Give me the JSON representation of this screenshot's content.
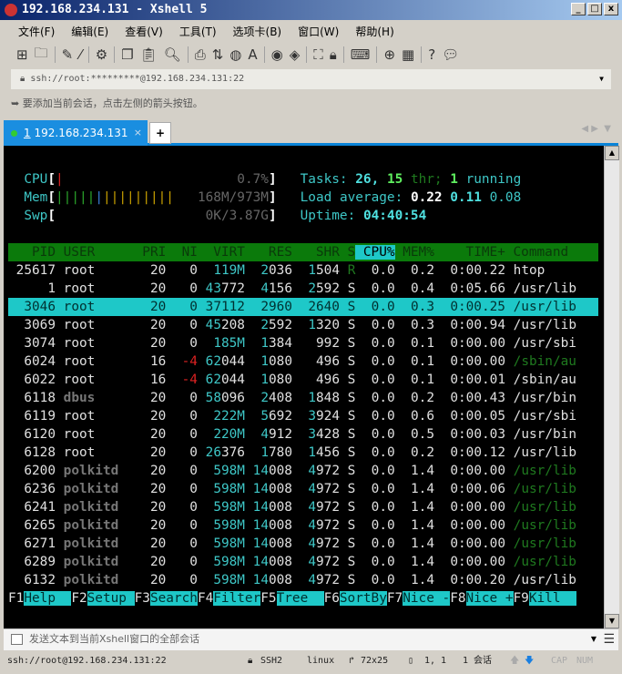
{
  "window": {
    "title": "192.168.234.131 - Xshell 5",
    "min": "_",
    "max": "□",
    "close": "x"
  },
  "menu": [
    "文件(F)",
    "编辑(E)",
    "查看(V)",
    "工具(T)",
    "选项卡(B)",
    "窗口(W)",
    "帮助(H)"
  ],
  "toolbar_icons": [
    "new-session-icon",
    "open-folder-icon",
    "connect-icon",
    "disconnect-icon",
    "properties-icon",
    "copy-icon",
    "paste-icon",
    "find-icon",
    "print-icon",
    "transfer-icon",
    "globe-icon",
    "font-icon",
    "xftp-icon",
    "xmanager-icon",
    "fullscreen-icon",
    "lock-icon",
    "keyboard-icon",
    "new-tab-icon",
    "layout-icon",
    "help-icon",
    "chat-icon"
  ],
  "address": {
    "value": "ssh://root:*********@192.168.234.131:22"
  },
  "hint": "要添加当前会话，点击左侧的箭头按钮。",
  "tab": {
    "number": "1",
    "label": "192.168.234.131",
    "close": "×",
    "add": "+"
  },
  "htop": {
    "cpu": {
      "label": "CPU",
      "percent": "0.7%",
      "bar_fraction": 0.007
    },
    "mem": {
      "label": "Mem",
      "value": "168M/973M",
      "bars": {
        "green": 5,
        "blue": 1,
        "yellow": 9
      }
    },
    "swp": {
      "label": "Swp",
      "value": "0K/3.87G"
    },
    "tasks": {
      "label": "Tasks:",
      "count": "26",
      "thr": "15",
      "thr_label": "thr;",
      "running": "1",
      "running_label": "running"
    },
    "load": {
      "label": "Load average:",
      "values": [
        "0.22",
        "0.11",
        "0.08"
      ]
    },
    "uptime": {
      "label": "Uptime:",
      "value": "04:40:54"
    },
    "columns": [
      "PID",
      "USER",
      "PRI",
      "NI",
      "VIRT",
      "RES",
      "SHR",
      "S",
      "CPU%",
      "MEM%",
      "TIME+",
      "Command"
    ],
    "sort_column": "CPU%",
    "selected_pid": "3046",
    "rows": [
      [
        "25617",
        "root",
        "20",
        "0",
        "119M",
        "2036",
        "1504",
        "R",
        "0.0",
        "0.2",
        "0:00.22",
        "htop",
        false
      ],
      [
        "1",
        "root",
        "20",
        "0",
        "43772",
        "4156",
        "2592",
        "S",
        "0.0",
        "0.4",
        "0:05.66",
        "/usr/lib",
        false
      ],
      [
        "3046",
        "root",
        "20",
        "0",
        "37112",
        "2960",
        "2640",
        "S",
        "0.0",
        "0.3",
        "0:00.25",
        "/usr/lib",
        false
      ],
      [
        "3069",
        "root",
        "20",
        "0",
        "45208",
        "2592",
        "1320",
        "S",
        "0.0",
        "0.3",
        "0:00.94",
        "/usr/lib",
        false
      ],
      [
        "3074",
        "root",
        "20",
        "0",
        "185M",
        "1384",
        "992",
        "S",
        "0.0",
        "0.1",
        "0:00.00",
        "/usr/sbi",
        false
      ],
      [
        "6024",
        "root",
        "16",
        "-4",
        "62044",
        "1080",
        "496",
        "S",
        "0.0",
        "0.1",
        "0:00.00",
        "/sbin/au",
        true
      ],
      [
        "6022",
        "root",
        "16",
        "-4",
        "62044",
        "1080",
        "496",
        "S",
        "0.0",
        "0.1",
        "0:00.01",
        "/sbin/au",
        false
      ],
      [
        "6118",
        "dbus",
        "20",
        "0",
        "58096",
        "2408",
        "1848",
        "S",
        "0.0",
        "0.2",
        "0:00.43",
        "/usr/bin",
        false
      ],
      [
        "6119",
        "root",
        "20",
        "0",
        "222M",
        "5692",
        "3924",
        "S",
        "0.0",
        "0.6",
        "0:00.05",
        "/usr/sbi",
        false
      ],
      [
        "6120",
        "root",
        "20",
        "0",
        "220M",
        "4912",
        "3428",
        "S",
        "0.0",
        "0.5",
        "0:00.03",
        "/usr/bin",
        false
      ],
      [
        "6128",
        "root",
        "20",
        "0",
        "26376",
        "1780",
        "1456",
        "S",
        "0.0",
        "0.2",
        "0:00.12",
        "/usr/lib",
        false
      ],
      [
        "6200",
        "polkitd",
        "20",
        "0",
        "598M",
        "14008",
        "4972",
        "S",
        "0.0",
        "1.4",
        "0:00.00",
        "/usr/lib",
        true
      ],
      [
        "6236",
        "polkitd",
        "20",
        "0",
        "598M",
        "14008",
        "4972",
        "S",
        "0.0",
        "1.4",
        "0:00.06",
        "/usr/lib",
        true
      ],
      [
        "6241",
        "polkitd",
        "20",
        "0",
        "598M",
        "14008",
        "4972",
        "S",
        "0.0",
        "1.4",
        "0:00.00",
        "/usr/lib",
        true
      ],
      [
        "6265",
        "polkitd",
        "20",
        "0",
        "598M",
        "14008",
        "4972",
        "S",
        "0.0",
        "1.4",
        "0:00.00",
        "/usr/lib",
        true
      ],
      [
        "6271",
        "polkitd",
        "20",
        "0",
        "598M",
        "14008",
        "4972",
        "S",
        "0.0",
        "1.4",
        "0:00.00",
        "/usr/lib",
        true
      ],
      [
        "6289",
        "polkitd",
        "20",
        "0",
        "598M",
        "14008",
        "4972",
        "S",
        "0.0",
        "1.4",
        "0:00.00",
        "/usr/lib",
        true
      ],
      [
        "6132",
        "polkitd",
        "20",
        "0",
        "598M",
        "14008",
        "4972",
        "S",
        "0.0",
        "1.4",
        "0:00.20",
        "/usr/lib",
        false
      ]
    ],
    "fkeys": [
      [
        "F1",
        "Help  "
      ],
      [
        "F2",
        "Setup "
      ],
      [
        "F3",
        "Search"
      ],
      [
        "F4",
        "Filter"
      ],
      [
        "F5",
        "Tree  "
      ],
      [
        "F6",
        "SortBy"
      ],
      [
        "F7",
        "Nice -"
      ],
      [
        "F8",
        "Nice +"
      ],
      [
        "F9",
        "Kill  "
      ]
    ]
  },
  "compose": {
    "placeholder": "发送文本到当前Xshell窗口的全部会话"
  },
  "status": {
    "address": "ssh://root@192.168.234.131:22",
    "protocol": "SSH2",
    "term": "linux",
    "size": "72x25",
    "cursor": "1, 1",
    "sessions": "1 会话",
    "cap": "CAP",
    "num": "NUM"
  },
  "colors": {
    "terminal_bg": "#000000",
    "header_bg": "#0b7a0b",
    "highlight": "#1ec8c8",
    "tab_active": "#1a8ee0"
  }
}
